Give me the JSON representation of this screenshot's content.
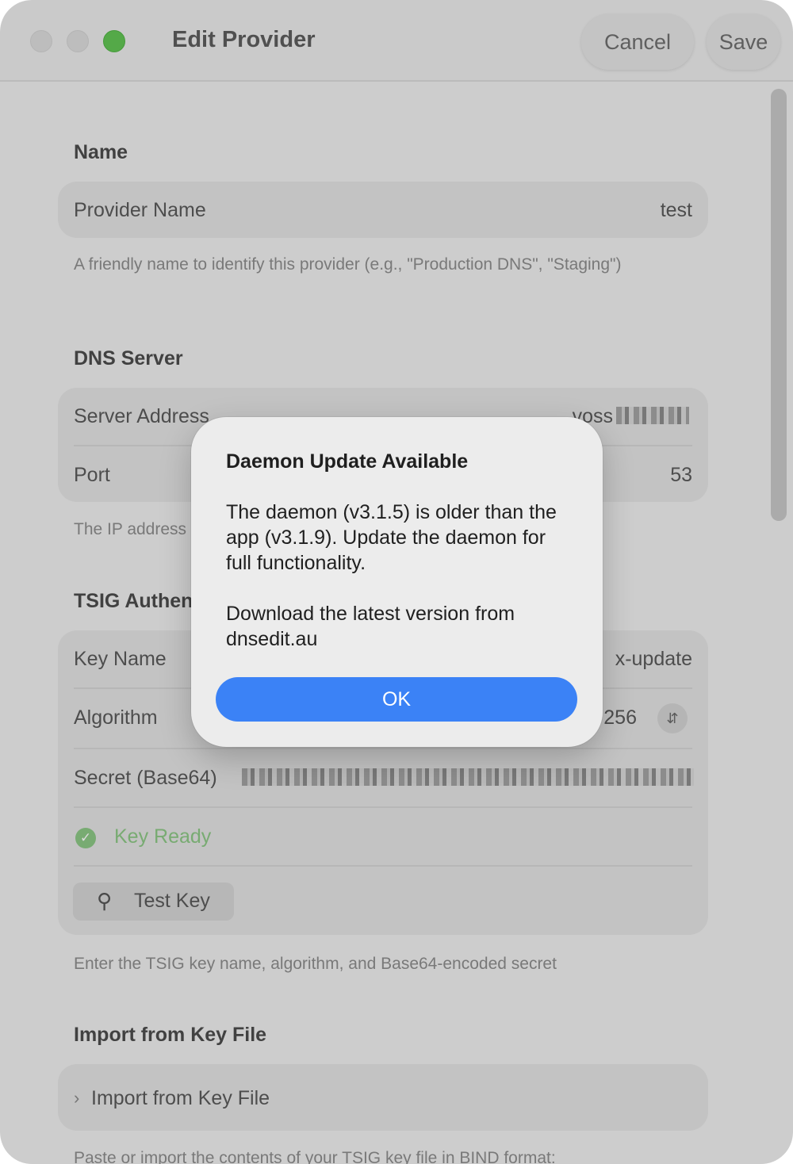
{
  "window": {
    "title": "Edit Provider",
    "cancel_label": "Cancel",
    "save_label": "Save"
  },
  "name_section": {
    "title": "Name",
    "provider_name_label": "Provider Name",
    "provider_name_value": "test",
    "help": "A friendly name to identify this provider (e.g., \"Production DNS\", \"Staging\")"
  },
  "dns_section": {
    "title": "DNS Server",
    "server_address_label": "Server Address",
    "server_address_value": "voss",
    "port_label": "Port",
    "port_value": "53",
    "help": "The IP address"
  },
  "tsig_section": {
    "title": "TSIG Authen",
    "key_name_label": "Key Name",
    "key_name_value": "x-update",
    "algorithm_label": "Algorithm",
    "algorithm_value": "256",
    "secret_label": "Secret (Base64)",
    "key_status": "Key Ready",
    "test_key_label": "Test Key",
    "help": "Enter the TSIG key name, algorithm, and Base64-encoded secret"
  },
  "import_section": {
    "title": "Import from Key File",
    "disclosure_label": "Import from Key File",
    "help": "Paste or import the contents of your TSIG key file in BIND format:"
  },
  "dialog": {
    "title": "Daemon Update Available",
    "message": "The daemon (v3.1.5) is older than the app (v3.1.9). Update the daemon for full functionality.",
    "message2": "Download the latest version from dnsedit.au",
    "ok_label": "OK"
  },
  "colors": {
    "accent": "#3b82f6",
    "success": "#8cc785",
    "zoom_button": "#62c554"
  }
}
